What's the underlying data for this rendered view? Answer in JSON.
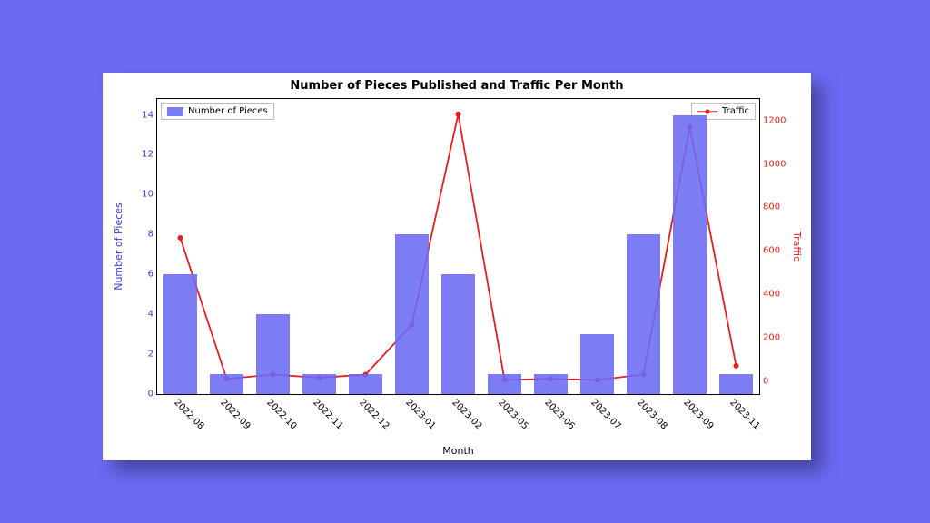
{
  "chart_data": {
    "type": "bar+line",
    "title": "Number of Pieces Published and Traffic Per Month",
    "categories": [
      "2022-08",
      "2022-09",
      "2022-10",
      "2022-11",
      "2022-12",
      "2023-01",
      "2023-02",
      "2023-05",
      "2023-06",
      "2023-07",
      "2023-08",
      "2023-09",
      "2023-11"
    ],
    "series": [
      {
        "name": "Number of Pieces",
        "kind": "bar",
        "axis": "left",
        "values": [
          6,
          1,
          4,
          1,
          1,
          8,
          6,
          1,
          1,
          3,
          8,
          14,
          1
        ],
        "color": "#6a6af4"
      },
      {
        "name": "Traffic",
        "kind": "line",
        "axis": "right",
        "values": [
          660,
          10,
          30,
          15,
          30,
          260,
          1230,
          5,
          10,
          5,
          30,
          1170,
          70
        ],
        "color": "#e02020"
      }
    ],
    "xlabel": "Month",
    "ylabel_left": "Number of Pieces",
    "ylabel_right": "Traffic",
    "ylim_left": [
      0,
      14.8
    ],
    "ylim_right": [
      -60,
      1300
    ],
    "yticks_left": [
      0,
      2,
      4,
      6,
      8,
      10,
      12,
      14
    ],
    "yticks_right": [
      0,
      200,
      400,
      600,
      800,
      1000,
      1200
    ],
    "legend_left": "Number of Pieces",
    "legend_right": "Traffic"
  }
}
